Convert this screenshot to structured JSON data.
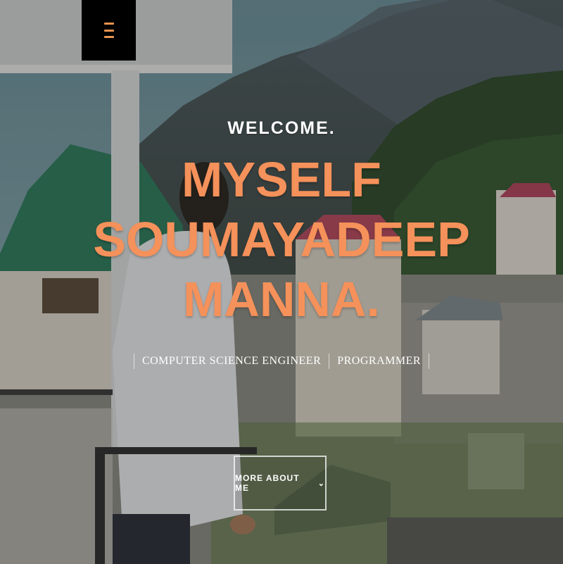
{
  "header": {
    "menu_icon": "hamburger-menu-icon",
    "accent_color": "#e89450"
  },
  "intro": {
    "welcome": "WELCOME.",
    "name_lines": [
      "MYSELF",
      "SOUMAYADEEP",
      "MANNA."
    ],
    "name_color": "#f5915a",
    "roles": [
      "COMPUTER SCIENCE ENGINEER",
      "PROGRAMMER"
    ]
  },
  "cta": {
    "label": "MORE ABOUT ME",
    "icon": "chevron-down-icon"
  }
}
